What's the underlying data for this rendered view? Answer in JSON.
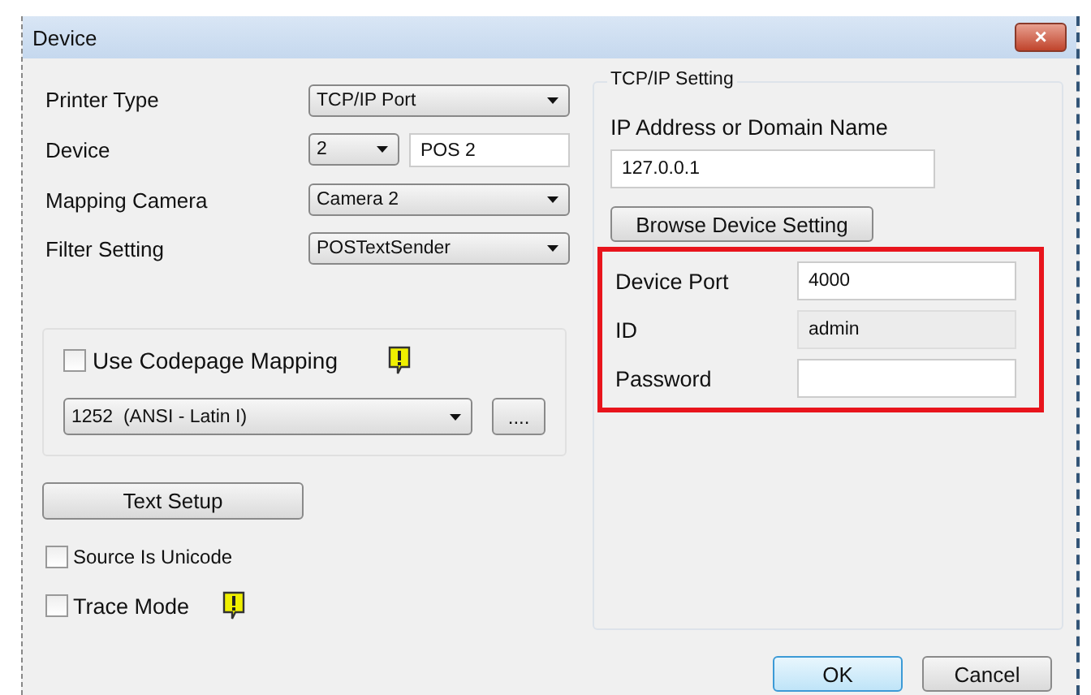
{
  "window": {
    "title": "Device",
    "close": "×"
  },
  "left": {
    "rows": [
      {
        "label": "Printer Type",
        "kind": "combo",
        "value": "TCP/IP Port"
      },
      {
        "label": "Device",
        "kind": "combo_text",
        "value": "2",
        "text": "POS 2"
      },
      {
        "label": "Mapping Camera",
        "kind": "combo",
        "value": "Camera 2"
      },
      {
        "label": "Filter Setting",
        "kind": "combo",
        "value": "POSTextSender"
      }
    ],
    "codepage": {
      "label": "Use Codepage Mapping",
      "checked": false,
      "value": "1252  (ANSI - Latin I)",
      "more": "...."
    },
    "text_setup": "Text Setup",
    "checks": [
      {
        "label": "Source Is Unicode",
        "checked": false,
        "warning": false
      },
      {
        "label": "Trace Mode",
        "checked": false,
        "warning": true
      }
    ]
  },
  "tcpip": {
    "title": "TCP/IP Setting",
    "address_label": "IP Address or Domain Name",
    "address": "127.0.0.1",
    "browse": "Browse Device Setting",
    "fields": [
      {
        "label": "Device Port",
        "value": "4000",
        "disabled": false
      },
      {
        "label": "ID",
        "value": "admin",
        "disabled": true
      },
      {
        "label": "Password",
        "disabled": false
      }
    ]
  },
  "buttons": [
    {
      "label": "OK",
      "default": true
    },
    {
      "label": "Cancel",
      "default": false
    }
  ]
}
